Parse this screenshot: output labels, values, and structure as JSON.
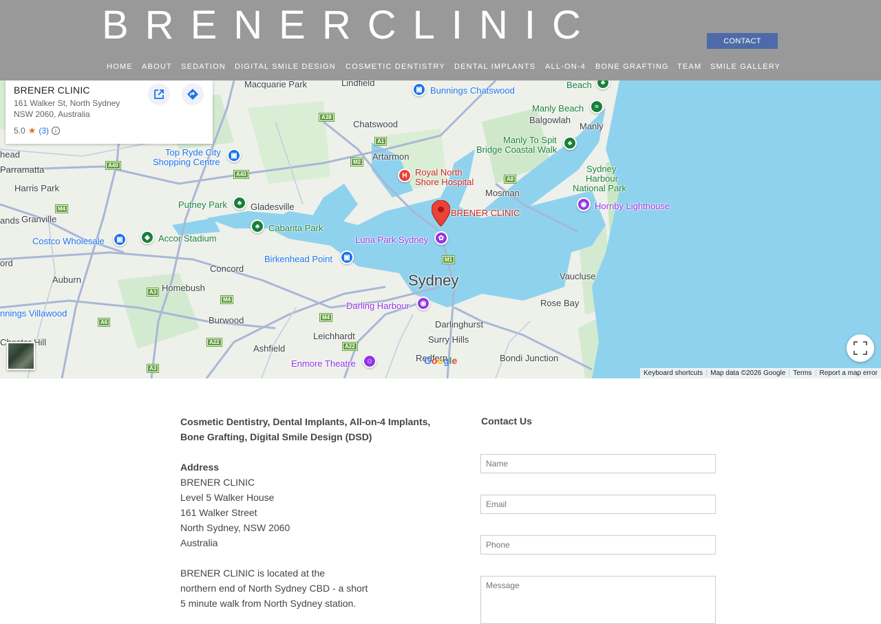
{
  "header": {
    "brand": "BRENERCLINIC",
    "contact_button": "CONTACT",
    "nav": [
      "HOME",
      "ABOUT",
      "SEDATION",
      "DIGITAL SMILE DESIGN",
      "COSMETIC DENTISTRY",
      "DENTAL IMPLANTS",
      "ALL-ON-4",
      "BONE GRAFTING",
      "TEAM",
      "SMILE GALLERY"
    ]
  },
  "map": {
    "place_card": {
      "title": "BRENER CLINIC",
      "address_line1": "161 Walker St, North Sydney",
      "address_line2": "NSW 2060, Australia",
      "rating": "5.0",
      "review_count": "(3)"
    },
    "labels": {
      "macquarie_park": "Macquarie Park",
      "lindfield": "Lindfield",
      "bunnings_chatswood": "Bunnings Chatswood",
      "beach": "Beach",
      "manly_beach": "Manly Beach",
      "balgowlah": "Balgowlah",
      "manly": "Manly",
      "chatswood": "Chatswood",
      "manly_to_spit": "Manly To Spit",
      "bridge_coastal_walk": "Bridge Coastal Walk",
      "head": "head",
      "top_ryde": "Top Ryde City",
      "shopping_centre": "Shopping Centre",
      "artarmon": "Artarmon",
      "royal_north": "Royal North",
      "shore_hospital": "Shore Hospital",
      "sydney_harbour1": "Sydney",
      "sydney_harbour2": "Harbour",
      "sydney_harbour3": "National Park",
      "parramatta": "Parramatta",
      "harris_park": "Harris Park",
      "mosman": "Mosman",
      "putney_park": "Putney Park",
      "gladesville": "Gladesville",
      "brener_clinic": "BRENER CLINIC",
      "hornby": "Hornby Lighthouse",
      "ands": "ands",
      "granville": "Granville",
      "cabarita": "Cabarita Park",
      "costco": "Costco Wholesale",
      "accor": "Accor Stadium",
      "luna_park": "Luna Park Sydney",
      "birkenhead": "Birkenhead Point",
      "ord": "ord",
      "concord": "Concord",
      "vaucluse": "Vaucluse",
      "auburn": "Auburn",
      "sydney": "Sydney",
      "homebush": "Homebush",
      "rose_bay": "Rose Bay",
      "darling_harbour": "Darling Harbour",
      "darlinghurst": "Darlinghurst",
      "bunnings_villawood": "nnings Villawood",
      "burwood": "Burwood",
      "leichhardt": "Leichhardt",
      "surry_hills": "Surry Hills",
      "chester_hill": "Chester Hill",
      "ashfield": "Ashfield",
      "bondi": "Bondi Junction",
      "enmore": "Enmore Theatre",
      "redfern": "Redfern"
    },
    "shields": {
      "a38": "A38",
      "a1": "A1",
      "m2": "M2",
      "a8": "A8",
      "a40a": "A40",
      "a40b": "A40",
      "m4a": "M4",
      "m1": "M1",
      "a3a": "A3",
      "m4b": "M4",
      "m4c": "M4",
      "a6": "A6",
      "a22a": "A22",
      "a22b": "A22",
      "a3b": "A3"
    },
    "google": "Google",
    "attribution": [
      "Keyboard shortcuts",
      "Map data ©2026 Google",
      "Terms",
      "Report a map error"
    ],
    "colors": {
      "water": "#8fd2ee",
      "land": "#eef0ea",
      "park": "#c9e7c4",
      "road": "#a9b7d6",
      "marker": "#ea4335"
    }
  },
  "content": {
    "services_line1": "Cosmetic Dentistry, Dental Implants, All-on-4 Implants,",
    "services_line2": "Bone Grafting, Digital Smile Design (DSD)",
    "address_heading": "Address",
    "address_lines": [
      "BRENER CLINIC",
      "Level 5 Walker House",
      "161 Walker Street",
      "North Sydney, NSW 2060",
      "Australia"
    ],
    "location_lines": [
      "BRENER CLINIC is located at the",
      "northern end of North Sydney CBD - a short",
      "5 minute walk from North Sydney station."
    ],
    "contact_title": "Contact Us",
    "form": {
      "name_placeholder": "Name",
      "email_placeholder": "Email",
      "phone_placeholder": "Phone",
      "message_placeholder": "Message"
    }
  }
}
